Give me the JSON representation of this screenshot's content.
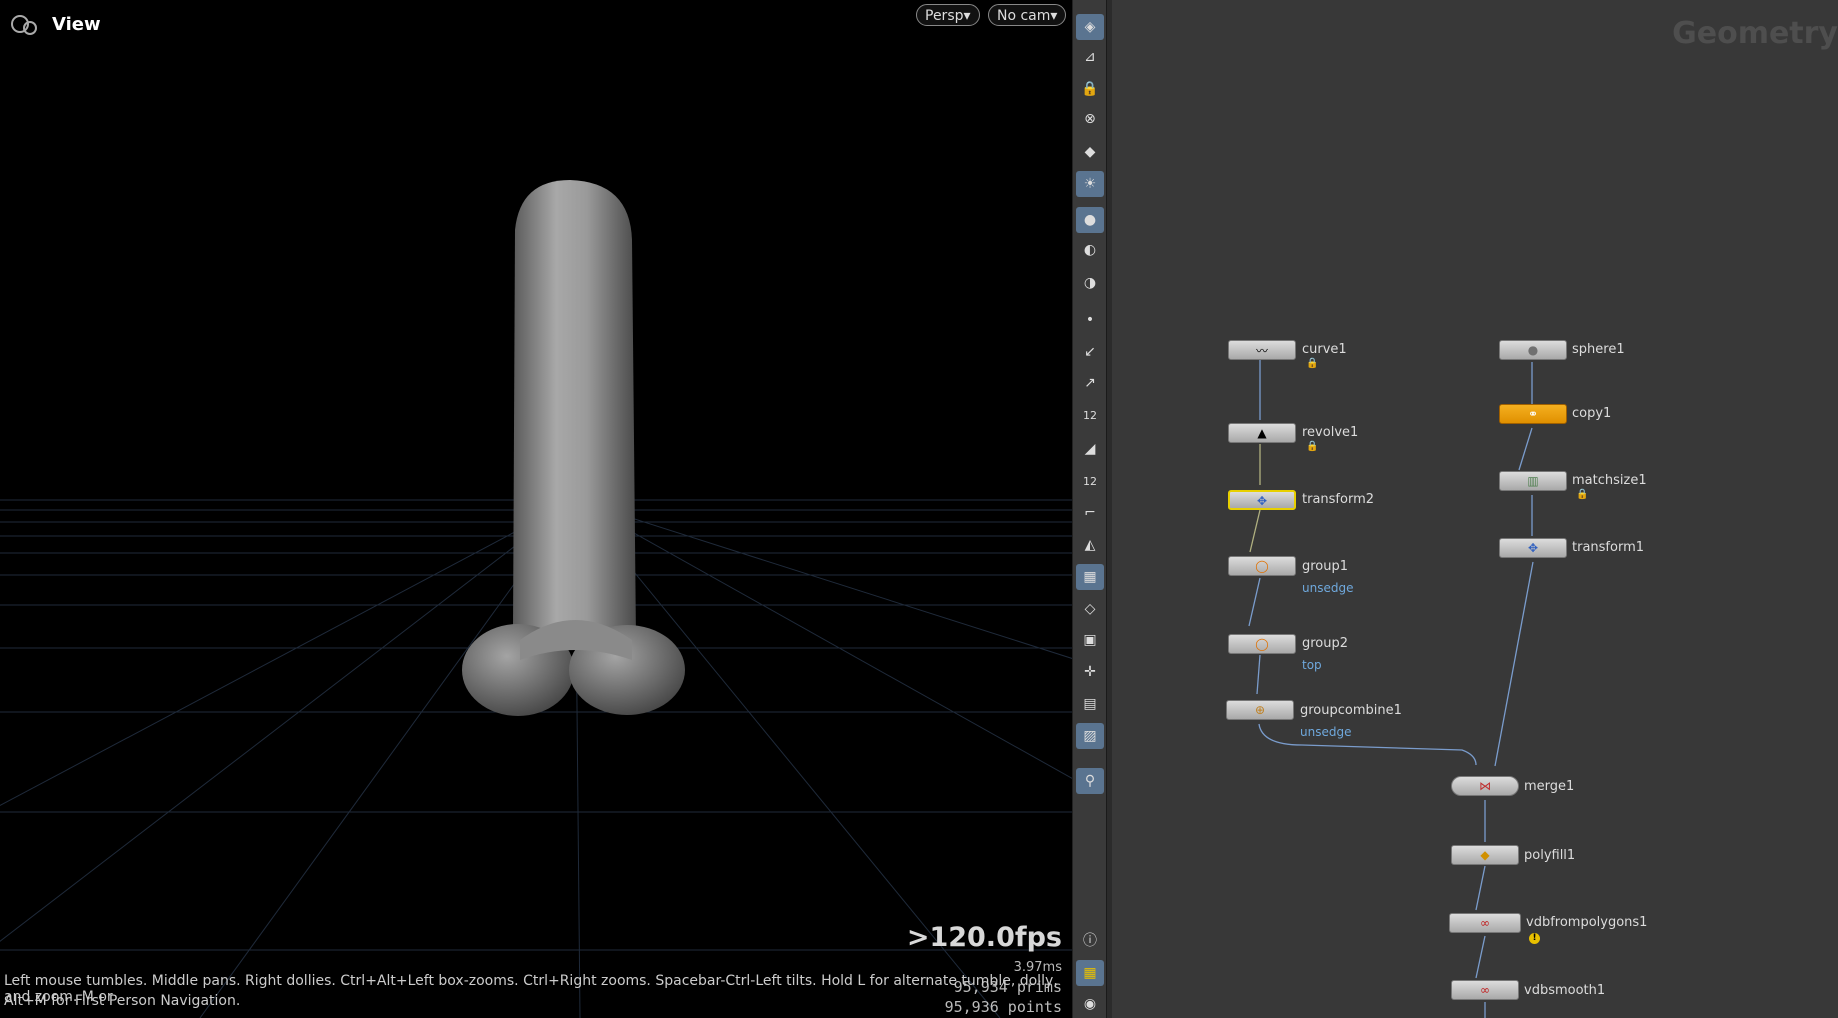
{
  "viewport": {
    "title": "View",
    "persp_label": "Persp",
    "cam_label": "No cam",
    "fps": ">120.0fps",
    "frame_time": "3.97ms",
    "prims": "95,934  prims",
    "points": "95,936 points",
    "hint_line1": "Left mouse tumbles. Middle pans. Right dollies. Ctrl+Alt+Left box-zooms. Ctrl+Right zooms. Spacebar-Ctrl-Left tilts. Hold L for alternate tumble, dolly, and zoom. M or",
    "hint_line2": "Alt+M for First Person Navigation."
  },
  "network": {
    "title": "Geometry",
    "nodes": [
      {
        "id": "curve1",
        "label": "curve1",
        "icon": "curve-icon"
      },
      {
        "id": "revolve1",
        "label": "revolve1",
        "icon": "revolve-icon"
      },
      {
        "id": "transform2",
        "label": "transform2",
        "icon": "transform-icon"
      },
      {
        "id": "group1",
        "label": "group1",
        "icon": "group-icon",
        "group": "unsedge"
      },
      {
        "id": "group2",
        "label": "group2",
        "icon": "group-icon",
        "group": "top"
      },
      {
        "id": "groupcombine1",
        "label": "groupcombine1",
        "icon": "groupcombine-icon",
        "group": "unsedge"
      },
      {
        "id": "sphere1",
        "label": "sphere1",
        "icon": "sphere-icon"
      },
      {
        "id": "copy1",
        "label": "copy1",
        "icon": "copy-icon"
      },
      {
        "id": "matchsize1",
        "label": "matchsize1",
        "icon": "matchsize-icon"
      },
      {
        "id": "transform1",
        "label": "transform1",
        "icon": "transform-icon"
      },
      {
        "id": "merge1",
        "label": "merge1",
        "icon": "merge-icon"
      },
      {
        "id": "polyfill1",
        "label": "polyfill1",
        "icon": "polyfill-icon"
      },
      {
        "id": "vdbfrompolygons1",
        "label": "vdbfrompolygons1",
        "icon": "vdb-icon"
      },
      {
        "id": "vdbsmooth1",
        "label": "vdbsmooth1",
        "icon": "vdb-icon"
      }
    ]
  },
  "toolbar": {
    "point_number_label": "12",
    "prim_number_label": "12"
  }
}
